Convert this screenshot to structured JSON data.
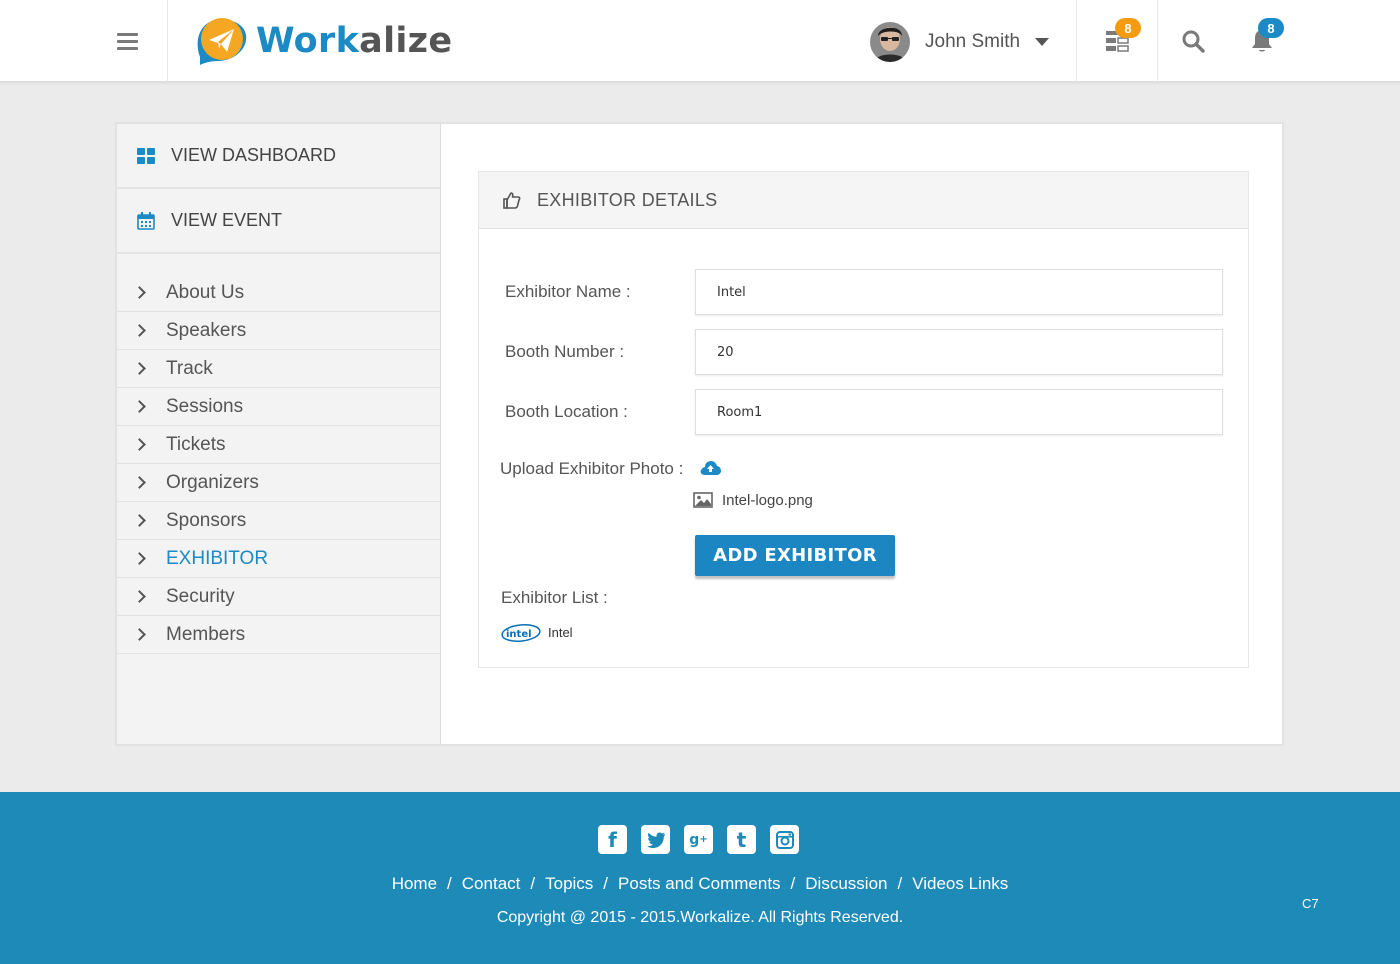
{
  "header": {
    "logo_part1": "Work",
    "logo_part2": "alize",
    "user_name": "John Smith",
    "tasks_badge": "8",
    "notifications_badge": "8"
  },
  "sidebar": {
    "dashboard_label": "VIEW DASHBOARD",
    "event_label": "VIEW EVENT",
    "items": [
      {
        "label": "About Us"
      },
      {
        "label": "Speakers"
      },
      {
        "label": "Track"
      },
      {
        "label": "Sessions"
      },
      {
        "label": "Tickets"
      },
      {
        "label": "Organizers"
      },
      {
        "label": "Sponsors"
      },
      {
        "label": "EXHIBITOR"
      },
      {
        "label": "Security"
      },
      {
        "label": "Members"
      }
    ]
  },
  "panel": {
    "title": "EXHIBITOR DETAILS",
    "name_label": "Exhibitor Name :",
    "name_value": "Intel",
    "booth_label": "Booth Number :",
    "booth_value": "20",
    "location_label": "Booth Location :",
    "location_value": "Room1",
    "photo_label": "Upload Exhibitor Photo :",
    "file_name": "Intel-logo.png",
    "add_button": "ADD EXHIBITOR",
    "list_label": "Exhibitor List :",
    "list_items": [
      {
        "logo": "intel",
        "name": "Intel"
      }
    ]
  },
  "footer": {
    "links": [
      "Home",
      "Contact",
      "Topics",
      "Posts and Comments",
      "Discussion",
      "Videos Links"
    ],
    "copyright": "Copyright @ 2015 - 2015.Workalize. All Rights Reserved.",
    "version": "C7"
  },
  "colors": {
    "accent": "#1c8ac4",
    "footer": "#1e8ab8",
    "badge_orange": "#f39c12",
    "badge_blue": "#1c8ac4"
  }
}
